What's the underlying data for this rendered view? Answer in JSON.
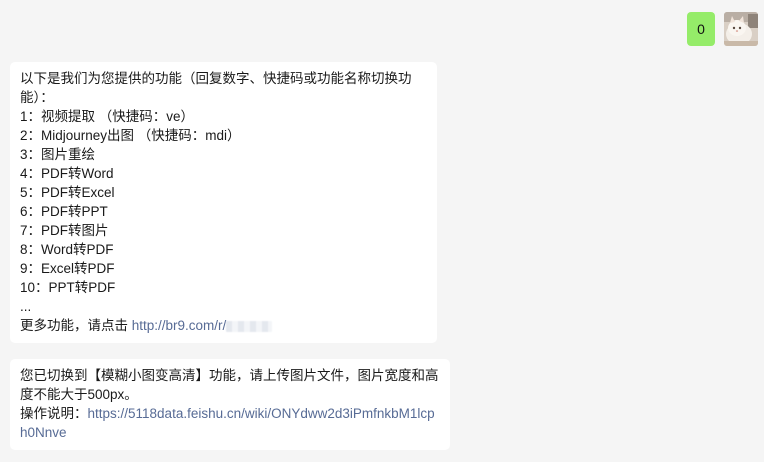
{
  "outgoing": {
    "text": "0"
  },
  "message1": {
    "intro": "以下是我们为您提供的功能（回复数字、快捷码或功能名称切换功能）：",
    "items": [
      "1：视频提取 （快捷码：ve）",
      "2：Midjourney出图 （快捷码：mdi）",
      "3：图片重绘",
      "4：PDF转Word",
      "5：PDF转Excel",
      "6：PDF转PPT",
      "7：PDF转图片",
      "8：Word转PDF",
      "9：Excel转PDF",
      "10：PPT转PDF",
      "..."
    ],
    "more_prefix": "更多功能，请点击 ",
    "more_link": "http://br9.com/r/"
  },
  "message2": {
    "text": "您已切换到【模糊小图变高清】功能，请上传图片文件，图片宽度和高度不能大于500px。",
    "instructions_prefix": "操作说明：",
    "instructions_link": "https://5118data.feishu.cn/wiki/ONYdww2d3iPmfnkbM1lcph0Nnve"
  },
  "colors": {
    "background": "#f5f5f5",
    "outgoing_bubble": "#95ec69",
    "incoming_bubble": "#ffffff",
    "link": "#576b95"
  },
  "icons": {
    "avatar": "cat-photo-avatar"
  }
}
